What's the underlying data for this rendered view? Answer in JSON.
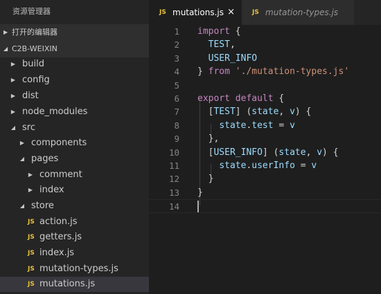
{
  "explorer": {
    "title": "资源管理器",
    "open_editors_label": "打开的编辑器",
    "project_label": "C2B-WEIXIN",
    "tree": [
      {
        "name": "build",
        "kind": "folder",
        "expanded": false
      },
      {
        "name": "config",
        "kind": "folder",
        "expanded": false
      },
      {
        "name": "dist",
        "kind": "folder",
        "expanded": false
      },
      {
        "name": "node_modules",
        "kind": "folder",
        "expanded": false
      },
      {
        "name": "src",
        "kind": "folder",
        "expanded": true
      },
      {
        "name": "components",
        "kind": "folder",
        "expanded": false
      },
      {
        "name": "pages",
        "kind": "folder",
        "expanded": true
      },
      {
        "name": "comment",
        "kind": "folder",
        "expanded": false
      },
      {
        "name": "index",
        "kind": "folder",
        "expanded": false
      },
      {
        "name": "store",
        "kind": "folder",
        "expanded": true
      },
      {
        "name": "action.js",
        "kind": "file"
      },
      {
        "name": "getters.js",
        "kind": "file"
      },
      {
        "name": "index.js",
        "kind": "file"
      },
      {
        "name": "mutation-types.js",
        "kind": "file"
      },
      {
        "name": "mutations.js",
        "kind": "file",
        "selected": true
      }
    ],
    "file_badge": "JS"
  },
  "tabs": [
    {
      "label": "mutations.js",
      "active": true,
      "badge": "JS",
      "close": "×"
    },
    {
      "label": "mutation-types.js",
      "active": false,
      "badge": "JS"
    }
  ],
  "editor": {
    "line_numbers": [
      "1",
      "2",
      "3",
      "4",
      "5",
      "6",
      "7",
      "8",
      "9",
      "10",
      "11",
      "12",
      "13",
      "14"
    ],
    "lines": [
      "import {",
      "  TEST,",
      "  USER_INFO",
      "} from './mutation-types.js'",
      "",
      "export default {",
      "  [TEST] (state, v) {",
      "    state.test = v",
      "  },",
      "  [USER_INFO] (state, v) {",
      "    state.userInfo = v",
      "  }",
      "}",
      ""
    ]
  },
  "colors": {
    "sidebar_bg": "#252526",
    "editor_bg": "#1e1e1e",
    "js_badge": "#e8c23a",
    "keyword": "#c586c0",
    "string": "#ce9178",
    "variable": "#9cdcfe"
  }
}
